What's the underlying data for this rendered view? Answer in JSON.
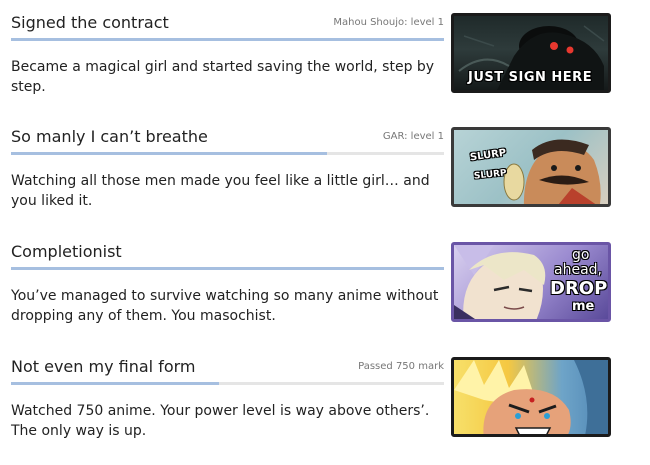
{
  "achievements": [
    {
      "title": "Signed the contract",
      "tag": "Mahou Shoujo: level 1",
      "progress": 1.0,
      "description": "Became a magical girl and started saving the world, step by step.",
      "image": {
        "icon": "contract-anime-icon",
        "caption": "JUST SIGN HERE"
      }
    },
    {
      "title": "So manly I can’t breathe",
      "tag": "GAR: level 1",
      "progress": 0.73,
      "description": "Watching all those men made you feel like a little girl… and you liked it.",
      "image": {
        "icon": "manly-anime-icon",
        "caption1": "SLURP",
        "caption2": "SLURP"
      }
    },
    {
      "title": "Completionist",
      "tag": "",
      "progress": 1.0,
      "description": "You’ve managed to survive watching so many anime without dropping any of them. You masochist.",
      "image": {
        "icon": "completionist-anime-icon",
        "caption1": "go",
        "caption2": "ahead,",
        "caption3": "DROP",
        "caption4": "me"
      }
    },
    {
      "title": "Not even my final form",
      "tag": "Passed 750 mark",
      "progress": 0.48,
      "description": "Watched 750 anime. Your power level is way above others’. The only way is up.",
      "image": {
        "icon": "final-form-anime-icon"
      }
    }
  ],
  "colors": {
    "progress_fill": "#a6bfe0",
    "progress_track": "#e5e5e5"
  }
}
